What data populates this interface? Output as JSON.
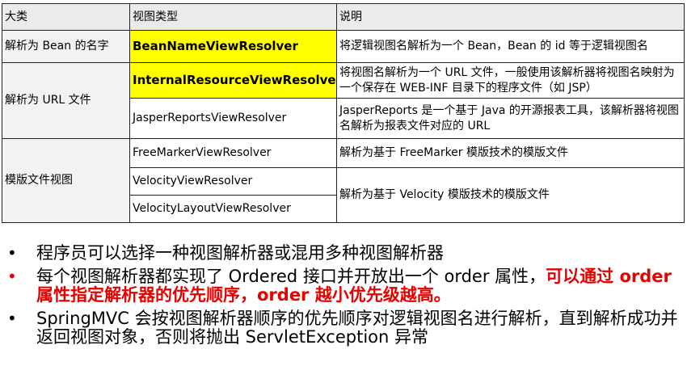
{
  "table": {
    "headers": [
      "大类",
      "视图类型",
      "说明"
    ],
    "groups": [
      {
        "category": "解析为 Bean 的名字",
        "rows": [
          {
            "type": "BeanNameViewResolver",
            "desc": "将逻辑视图名解析为一个 Bean，Bean 的 id 等于逻辑视图名"
          }
        ]
      },
      {
        "category": "解析为 URL 文件",
        "rows": [
          {
            "type": "InternalResourceViewResolver",
            "desc": "将视图名解析为一个 URL 文件，一般使用该解析器将视图名映射为一个保存在 WEB-INF 目录下的程序文件（如 JSP）"
          },
          {
            "type": "JasperReportsViewResolver",
            "desc": "JasperReports 是一个基于 Java 的开源报表工具，该解析器将视图名解析为报表文件对应的 URL"
          }
        ]
      },
      {
        "category": "模版文件视图",
        "rows": [
          {
            "type": "FreeMarkerViewResolver",
            "desc": "解析为基于 FreeMarker 模版技术的模版文件"
          },
          {
            "type": "VelocityViewResolver"
          },
          {
            "type": "VelocityLayoutViewResolver"
          }
        ],
        "shared_desc": "解析为基于 Velocity 模版技术的模版文件"
      }
    ]
  },
  "bullets": [
    {
      "symbol": "•",
      "text": "程序员可以选择一种视图解析器或混用多种视图解析器"
    },
    {
      "symbol": "•",
      "plain": "每个视图解析器都实现了 Ordered 接口并开放出一个 order 属性，",
      "emphasis": "可以通过 order 属性指定解析器的优先顺序，order 越小优先级越高。"
    },
    {
      "symbol": "•",
      "text": "SpringMVC 会按视图解析器顺序的优先顺序对逻辑视图名进行解析，直到解析成功并返回视图对象，否则将抛出 ServletException 异常"
    }
  ],
  "colors": {
    "highlight": "#ffff00",
    "emphasis": "#e60000",
    "header_bg": "#ebebeb"
  }
}
